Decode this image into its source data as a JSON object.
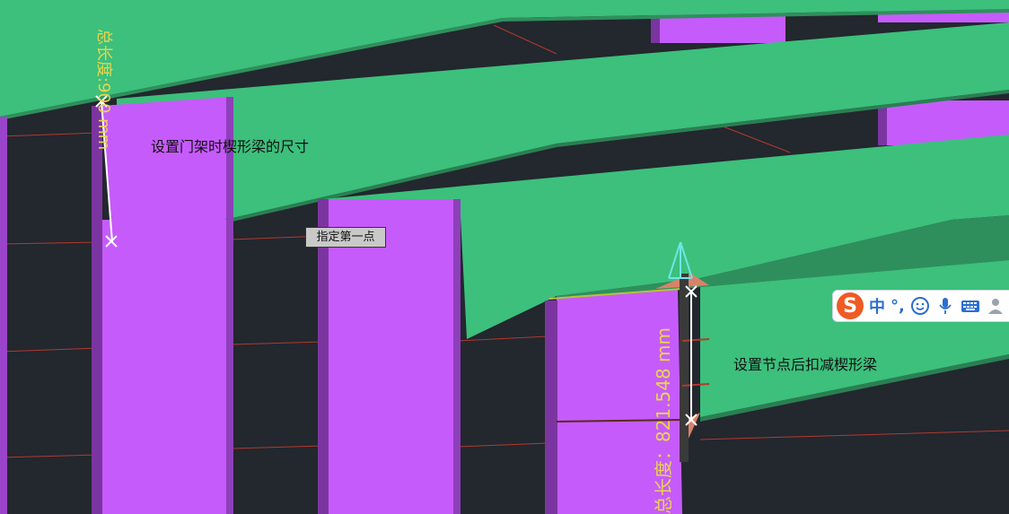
{
  "annotations": {
    "wedge_beam_note": "设置门架时楔形梁的尺寸",
    "deduct_note": "设置节点后扣减楔形梁"
  },
  "prompt": {
    "text": "指定第一点"
  },
  "dimensions": {
    "left_label": "总长度",
    "left_value": "900 mm",
    "left_full": "总长度:900 mm",
    "right_full": "总长度：821.548 mm"
  },
  "ime": {
    "logo": "S",
    "mode": "中",
    "punct": "°,",
    "icons": [
      "emoji-icon",
      "microphone-icon",
      "keyboard-icon",
      "user-icon"
    ]
  },
  "colors": {
    "background": "#23272e",
    "beam_green": "#3cc07c",
    "column_purple": "#c65bfb",
    "dimension_text": "#e7d64c",
    "grid_red": "#c0392b"
  }
}
